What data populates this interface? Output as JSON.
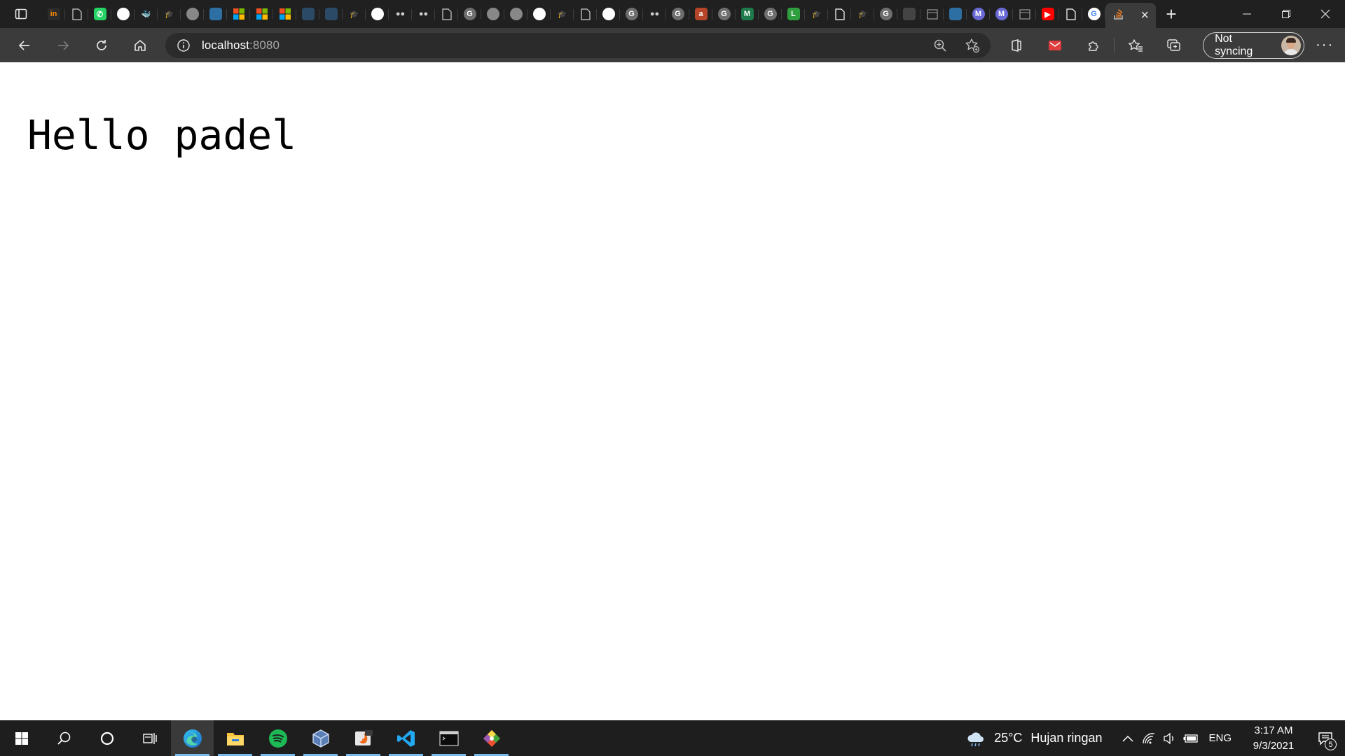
{
  "browser": {
    "tabs": [
      {
        "icon": "invision-icon",
        "glyph": "in",
        "bg": "#2b2b2b",
        "fg": "#ff8a00"
      },
      {
        "icon": "blank-page-icon",
        "glyph": "",
        "bg": "transparent",
        "fg": "#cfcfcf"
      },
      {
        "icon": "whatsapp-icon",
        "glyph": "✆",
        "bg": "#25d366",
        "fg": "#ffffff"
      },
      {
        "icon": "github-icon",
        "glyph": "",
        "bg": "#ffffff",
        "fg": "#000000"
      },
      {
        "icon": "docker-icon",
        "glyph": "🐳",
        "bg": "transparent",
        "fg": "#2496ed"
      },
      {
        "icon": "graduation-cap-icon",
        "glyph": "🎓",
        "bg": "transparent",
        "fg": "#cccccc"
      },
      {
        "icon": "github-icon",
        "glyph": "",
        "bg": "#888888",
        "fg": "#000000"
      },
      {
        "icon": "edge-icon",
        "glyph": "",
        "bg": "#2d6ea3",
        "fg": "#ffffff"
      },
      {
        "icon": "microsoft-icon",
        "glyph": "",
        "bg": "#f25022",
        "fg": "#ffffff"
      },
      {
        "icon": "microsoft-icon",
        "glyph": "",
        "bg": "#f25022",
        "fg": "#ffffff"
      },
      {
        "icon": "microsoft-icon",
        "glyph": "",
        "bg": "#f25022",
        "fg": "#ffffff"
      },
      {
        "icon": "globe-icon",
        "glyph": "",
        "bg": "#2a4a66",
        "fg": "#ffffff"
      },
      {
        "icon": "globe-icon",
        "glyph": "",
        "bg": "#2a4a66",
        "fg": "#ffffff"
      },
      {
        "icon": "graduation-cap-icon",
        "glyph": "🎓",
        "bg": "transparent",
        "fg": "#cccccc"
      },
      {
        "icon": "github-icon",
        "glyph": "",
        "bg": "#ffffff",
        "fg": "#000000"
      },
      {
        "icon": "medium-icon",
        "glyph": "●●",
        "bg": "transparent",
        "fg": "#cccccc"
      },
      {
        "icon": "medium-icon",
        "glyph": "●●",
        "bg": "transparent",
        "fg": "#cccccc"
      },
      {
        "icon": "blank-page-icon",
        "glyph": "",
        "bg": "transparent",
        "fg": "#cfcfcf"
      },
      {
        "icon": "google-icon",
        "glyph": "G",
        "bg": "#6e6e6e",
        "fg": "#ffffff"
      },
      {
        "icon": "github-icon",
        "glyph": "",
        "bg": "#888888",
        "fg": "#000000"
      },
      {
        "icon": "github-icon",
        "glyph": "",
        "bg": "#888888",
        "fg": "#000000"
      },
      {
        "icon": "github-icon",
        "glyph": "",
        "bg": "#ffffff",
        "fg": "#000000"
      },
      {
        "icon": "graduation-cap-icon",
        "glyph": "🎓",
        "bg": "transparent",
        "fg": "#cccccc"
      },
      {
        "icon": "blank-page-icon",
        "glyph": "",
        "bg": "transparent",
        "fg": "#cfcfcf"
      },
      {
        "icon": "github-icon",
        "glyph": "",
        "bg": "#ffffff",
        "fg": "#000000"
      },
      {
        "icon": "google-icon",
        "glyph": "G",
        "bg": "#6e6e6e",
        "fg": "#ffffff"
      },
      {
        "icon": "medium-icon",
        "glyph": "●●",
        "bg": "transparent",
        "fg": "#cccccc"
      },
      {
        "icon": "google-icon",
        "glyph": "G",
        "bg": "#6e6e6e",
        "fg": "#ffffff"
      },
      {
        "icon": "ask-icon",
        "glyph": "a",
        "bg": "#b5462a",
        "fg": "#ffffff"
      },
      {
        "icon": "google-icon",
        "glyph": "G",
        "bg": "#6e6e6e",
        "fg": "#ffffff"
      },
      {
        "icon": "m-icon",
        "glyph": "M",
        "bg": "#1e7a4a",
        "fg": "#ffffff"
      },
      {
        "icon": "google-icon",
        "glyph": "G",
        "bg": "#6e6e6e",
        "fg": "#ffffff"
      },
      {
        "icon": "l-icon",
        "glyph": "L",
        "bg": "#2e9e3e",
        "fg": "#ffffff"
      },
      {
        "icon": "graduation-cap-icon",
        "glyph": "🎓",
        "bg": "transparent",
        "fg": "#cccccc"
      },
      {
        "icon": "page-gear-icon",
        "glyph": "",
        "bg": "transparent",
        "fg": "#ffffff"
      },
      {
        "icon": "graduation-cap-icon",
        "glyph": "🎓",
        "bg": "transparent",
        "fg": "#cccccc"
      },
      {
        "icon": "google-icon",
        "glyph": "G",
        "bg": "#6e6e6e",
        "fg": "#ffffff"
      },
      {
        "icon": "paint-icon",
        "glyph": "",
        "bg": "#444444",
        "fg": "#ffffff"
      },
      {
        "icon": "calendar-icon",
        "glyph": "",
        "bg": "transparent",
        "fg": "#9a9a9a"
      },
      {
        "icon": "edge-icon",
        "glyph": "",
        "bg": "#2d6ea3",
        "fg": "#ffffff"
      },
      {
        "icon": "m-circle-icon",
        "glyph": "M",
        "bg": "#6a6ad6",
        "fg": "#ffffff"
      },
      {
        "icon": "m-circle-icon",
        "glyph": "M",
        "bg": "#6a6ad6",
        "fg": "#ffffff"
      },
      {
        "icon": "calendar-icon",
        "glyph": "",
        "bg": "transparent",
        "fg": "#9a9a9a"
      },
      {
        "icon": "youtube-icon",
        "glyph": "▶",
        "bg": "#ff0000",
        "fg": "#ffffff"
      },
      {
        "icon": "blank-page-icon",
        "glyph": "",
        "bg": "transparent",
        "fg": "#ffffff"
      },
      {
        "icon": "google-icon",
        "glyph": "G",
        "bg": "#ffffff",
        "fg": "#4285f4"
      }
    ],
    "active_tab": {
      "icon": "stackoverflow-icon",
      "close": "×"
    },
    "new_tab_label": "+",
    "address": {
      "host": "localhost",
      "port": ":8080"
    },
    "sync_label": "Not syncing",
    "more_label": "···"
  },
  "page": {
    "heading": "Hello padel"
  },
  "taskbar": {
    "weather_temp": "25°C",
    "weather_desc": "Hujan ringan",
    "language": "ENG",
    "time": "3:17 AM",
    "date": "9/3/2021",
    "notification_count": "5",
    "colors": {
      "accent": "#76b9ed",
      "spotify": "#1db954",
      "vscode": "#23a9f2",
      "edge": "#2fa9e0"
    }
  }
}
